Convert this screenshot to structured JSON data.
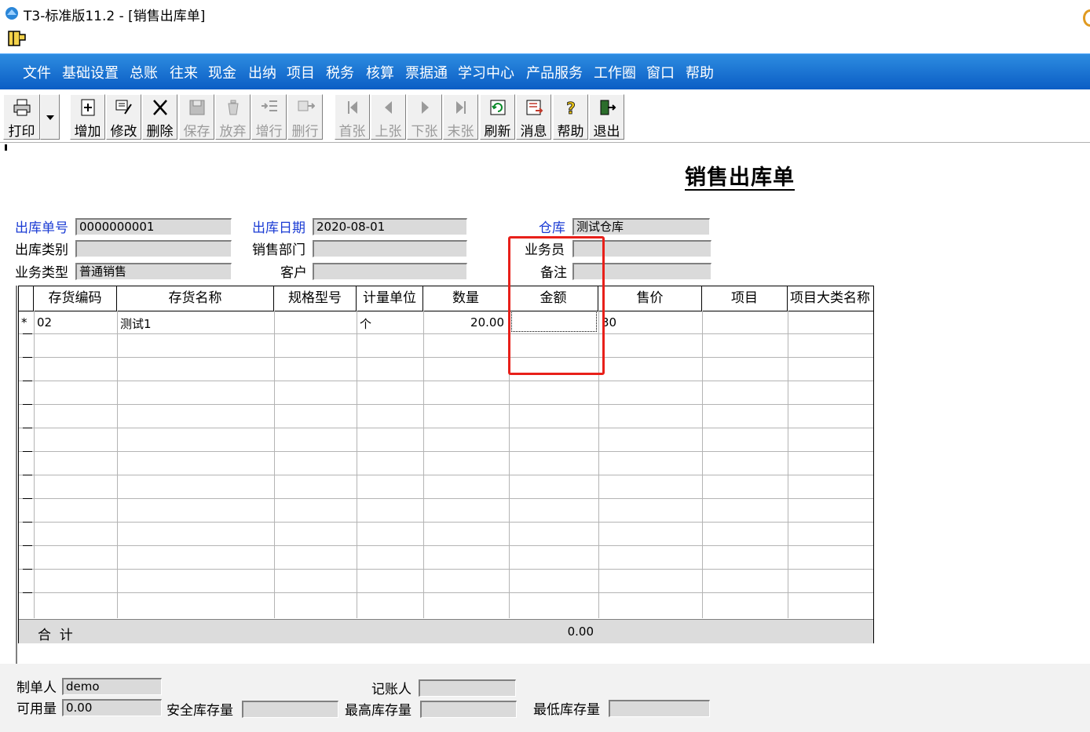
{
  "window": {
    "title": "T3-标准版11.2 - [销售出库单]"
  },
  "menu": [
    "文件",
    "基础设置",
    "总账",
    "往来",
    "现金",
    "出纳",
    "项目",
    "税务",
    "核算",
    "票据通",
    "学习中心",
    "产品服务",
    "工作圈",
    "窗口",
    "帮助"
  ],
  "toolbar": {
    "buttons": [
      {
        "label": "打印",
        "icon": "printer-icon",
        "enabled": true
      },
      {
        "label": "增加",
        "icon": "add-doc-icon",
        "enabled": true
      },
      {
        "label": "修改",
        "icon": "edit-icon",
        "enabled": true
      },
      {
        "label": "删除",
        "icon": "delete-x-icon",
        "enabled": true
      },
      {
        "label": "保存",
        "icon": "save-icon",
        "enabled": false
      },
      {
        "label": "放弃",
        "icon": "trash-icon",
        "enabled": false
      },
      {
        "label": "增行",
        "icon": "add-row-icon",
        "enabled": false
      },
      {
        "label": "删行",
        "icon": "delete-row-icon",
        "enabled": false
      },
      {
        "label": "首张",
        "icon": "first-record-icon",
        "enabled": false
      },
      {
        "label": "上张",
        "icon": "prev-record-icon",
        "enabled": false
      },
      {
        "label": "下张",
        "icon": "next-record-icon",
        "enabled": false
      },
      {
        "label": "末张",
        "icon": "last-record-icon",
        "enabled": false
      },
      {
        "label": "刷新",
        "icon": "refresh-icon",
        "enabled": true
      },
      {
        "label": "消息",
        "icon": "message-icon",
        "enabled": true
      },
      {
        "label": "帮助",
        "icon": "help-icon",
        "enabled": true
      },
      {
        "label": "退出",
        "icon": "exit-icon",
        "enabled": true
      }
    ]
  },
  "document": {
    "title": "销售出库单",
    "header_fields": {
      "out_no": {
        "label": "出库单号",
        "value": "0000000001"
      },
      "out_date": {
        "label": "出库日期",
        "value": "2020-08-01"
      },
      "warehouse": {
        "label": "仓库",
        "value": "测试仓库"
      },
      "out_category": {
        "label": "出库类别",
        "value": ""
      },
      "sales_dept": {
        "label": "销售部门",
        "value": ""
      },
      "salesperson": {
        "label": "业务员",
        "value": ""
      },
      "business_type": {
        "label": "业务类型",
        "value": "普通销售"
      },
      "customer": {
        "label": "客户",
        "value": ""
      },
      "remark": {
        "label": "备注",
        "value": ""
      }
    }
  },
  "grid": {
    "columns": [
      "存货编码",
      "存货名称",
      "规格型号",
      "计量单位",
      "数量",
      "金额",
      "售价",
      "项目",
      "项目大类名称"
    ],
    "rows": [
      {
        "marker": "*",
        "code": "02",
        "name": "测试1",
        "spec": "",
        "unit": "个",
        "qty": "20.00",
        "amount": "",
        "price": "30",
        "project": "",
        "project_cat": ""
      }
    ],
    "total": {
      "label": "合  计",
      "amount": "0.00"
    }
  },
  "footer": {
    "creator": {
      "label": "制单人",
      "value": "demo"
    },
    "bookkeeper": {
      "label": "记账人",
      "value": ""
    },
    "available_qty": {
      "label": "可用量",
      "value": "0.00"
    },
    "safety_stock": {
      "label": "安全库存量",
      "value": ""
    },
    "max_stock": {
      "label": "最高库存量",
      "value": ""
    },
    "min_stock": {
      "label": "最低库存量",
      "value": ""
    }
  },
  "colors": {
    "menu_bar": "#0a5cc4",
    "label_blue": "#1a3bd4",
    "highlight_red": "#e8201a"
  }
}
